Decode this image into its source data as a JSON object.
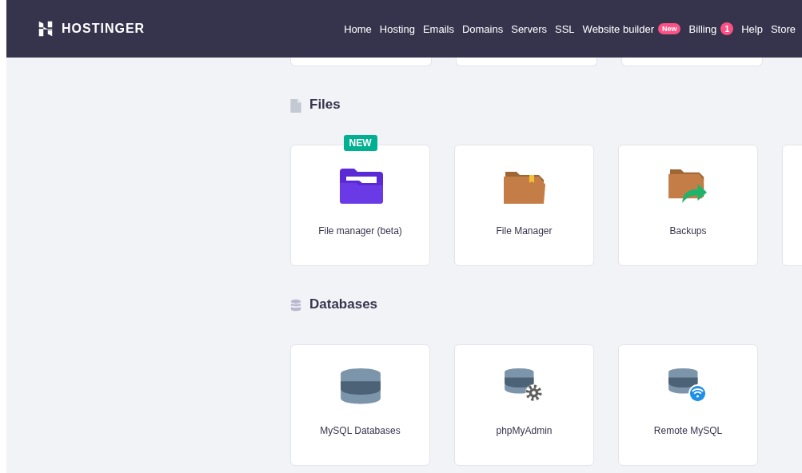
{
  "header": {
    "brand": "HOSTINGER",
    "nav": [
      {
        "label": "Home"
      },
      {
        "label": "Hosting"
      },
      {
        "label": "Emails"
      },
      {
        "label": "Domains"
      },
      {
        "label": "Servers"
      },
      {
        "label": "SSL"
      },
      {
        "label": "Website builder",
        "badge": "New",
        "kind": "pill"
      },
      {
        "label": "Billing",
        "badge": "1",
        "kind": "count"
      },
      {
        "label": "Help"
      },
      {
        "label": "Store"
      }
    ]
  },
  "sections": [
    {
      "tiles": [
        {
          "kind": "partial"
        },
        {
          "kind": "partial"
        },
        {
          "kind": "partial"
        }
      ]
    },
    {
      "title": "Files",
      "kind": "file",
      "tiles": [
        {
          "kind": "purple-folder",
          "label": "File manager (beta)",
          "badge": "NEW"
        },
        {
          "kind": "folder",
          "label": "File Manager"
        },
        {
          "kind": "backup",
          "label": "Backups"
        },
        {
          "kind": "blank"
        }
      ]
    },
    {
      "title": "Databases",
      "kind": "database",
      "tiles": [
        {
          "kind": "database",
          "label": "MySQL Databases"
        },
        {
          "kind": "db-gear",
          "label": "phpMyAdmin"
        },
        {
          "kind": "db-wifi",
          "label": "Remote MySQL"
        }
      ]
    }
  ]
}
